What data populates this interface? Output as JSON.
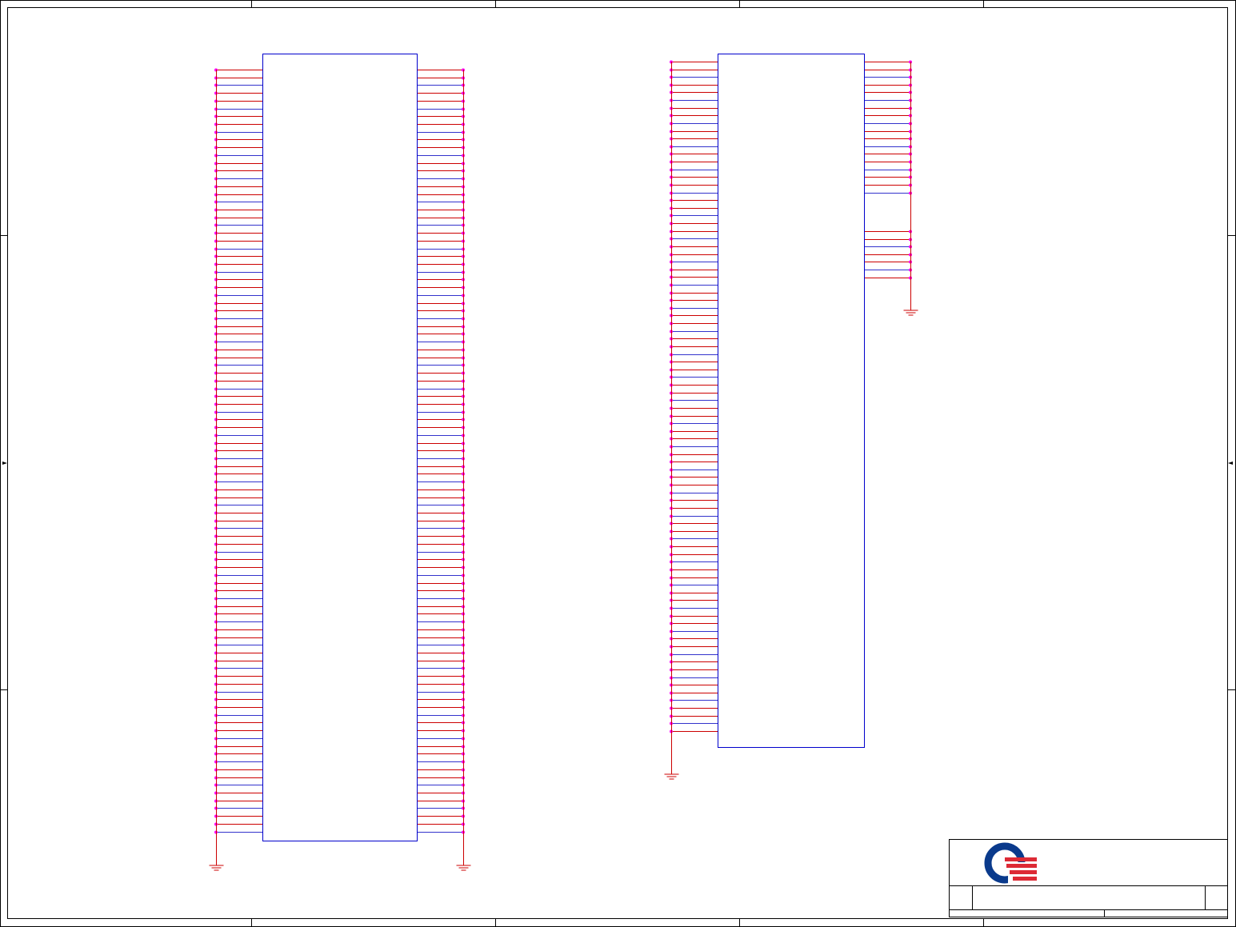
{
  "colors": {
    "frame": "#000000",
    "wire": "#cc0000",
    "wire_alt": "#3333cc",
    "component_outline": "#0000cc",
    "junction_dot": "#ff00ff",
    "ground": "#cc0000",
    "logo_blue": "#0a3a8c",
    "logo_red": "#dd2a35"
  },
  "components": [
    {
      "id": "left-connector",
      "left_pins": 99,
      "right_pins": 99
    },
    {
      "id": "right-connector",
      "left_pins": 88,
      "right_pins_upper": 18,
      "right_pins_lower": 7
    }
  ],
  "ground_symbols": 4,
  "title_block": {
    "logo": "company-logo"
  }
}
